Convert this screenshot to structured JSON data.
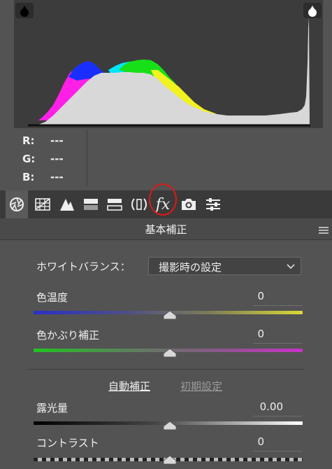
{
  "histogram": {
    "readout": [
      {
        "label": "R:",
        "value": "---"
      },
      {
        "label": "G:",
        "value": "---"
      },
      {
        "label": "B:",
        "value": "---"
      }
    ]
  },
  "toolbar": {
    "icons": [
      "aperture-icon",
      "grid-icon",
      "tone-curve-icon",
      "hsl-icon",
      "split-toning-icon",
      "lens-icon",
      "fx-icon",
      "camera-icon",
      "sliders-icon"
    ],
    "fx_label": "fx",
    "highlight_color": "#e01818"
  },
  "panel": {
    "title": "基本補正",
    "white_balance": {
      "label": "ホワイトバランス：",
      "selected": "撮影時の設定"
    },
    "temperature": {
      "label": "色温度",
      "value": "0",
      "level": 0.5
    },
    "tint": {
      "label": "色かぶり補正",
      "value": "0",
      "level": 0.5
    },
    "auto_label": "自動補正",
    "default_label": "初期設定",
    "exposure": {
      "label": "露光量",
      "value": "0.00",
      "level": 0.5
    },
    "contrast": {
      "label": "コントラスト",
      "value": "0",
      "level": 0.5
    }
  }
}
